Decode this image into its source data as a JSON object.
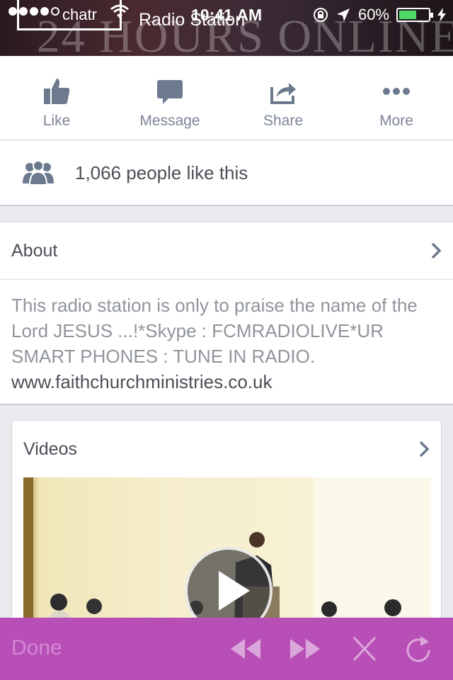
{
  "status_bar": {
    "carrier": "chatr",
    "page_name": "Radio Station",
    "time": "10:41 AM",
    "battery": "60%",
    "battery_level": 0.6
  },
  "cover": {
    "background_text": "24 HOURS ONLINE"
  },
  "actions": [
    {
      "label": "Like",
      "icon": "thumbs-up-icon"
    },
    {
      "label": "Message",
      "icon": "message-icon"
    },
    {
      "label": "Share",
      "icon": "share-icon"
    },
    {
      "label": "More",
      "icon": "more-icon"
    }
  ],
  "likes": {
    "text": "1,066 people like this",
    "icon": "people-icon"
  },
  "about": {
    "title": "About",
    "description": "This radio station is only to praise the name of the Lord JESUS ...!*Skype : FCMRADIOLIVE*UR SMART PHONES : TUNE IN RADIO.",
    "link": "www.faithchurchministries.co.uk"
  },
  "videos": {
    "title": "Videos"
  },
  "toolbar": {
    "done_label": "Done",
    "icons": [
      "rewind-icon",
      "fast-forward-icon",
      "close-icon",
      "refresh-icon"
    ]
  },
  "colors": {
    "toolbar_bg": "#b84fb7",
    "text_primary": "#4b4f56",
    "text_secondary": "#90949c",
    "battery_fill": "#4cd964"
  }
}
